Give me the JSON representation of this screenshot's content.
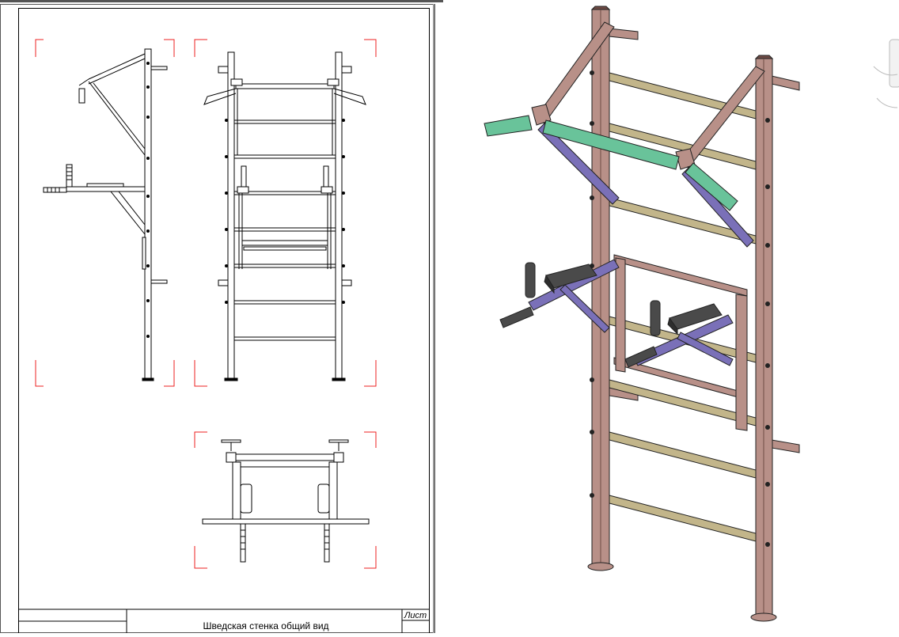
{
  "drawing_sheet": {
    "title_block": {
      "drawing_title": "Шведская стенка общий вид",
      "sheet_label": "Лист"
    }
  },
  "views": [
    {
      "name": "side-view"
    },
    {
      "name": "front-view"
    },
    {
      "name": "top-view"
    }
  ],
  "model_3d": {
    "colors": {
      "frame": "#b89088",
      "frame_dark": "#6e4b45",
      "rungs": "#c2b58a",
      "bars_blue": "#7a70b8",
      "grip_foam": "#69c39a",
      "pad": "#4a4a4a"
    }
  },
  "view_cube": {
    "icon": "view-cube-icon"
  }
}
